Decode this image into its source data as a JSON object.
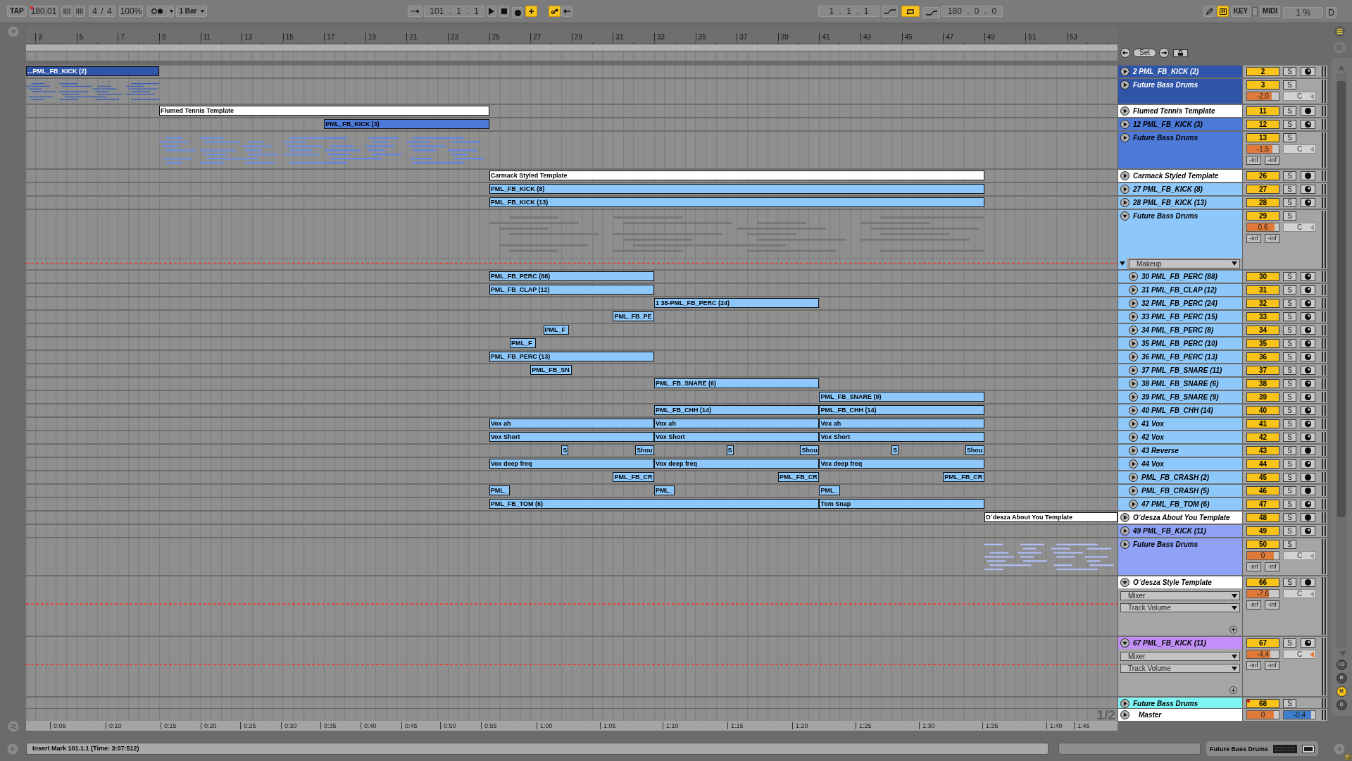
{
  "toolbar": {
    "tap": "TAP",
    "tempo": "180.01",
    "tempo_flag": true,
    "signature": "4 / 4",
    "zoom": "100%",
    "quantization": "1 Bar",
    "position": "101 . 1 . 1",
    "overdub": {
      "label": "+",
      "on": true
    },
    "automation_arm": {
      "on": true
    },
    "loop_start": "1 . 1 . 1",
    "loop": {
      "on": true
    },
    "loop_length": "180 . 0 . 0",
    "keyboard": {
      "on": true
    },
    "key": "KEY",
    "midi": "MIDI",
    "cpu": "1 %",
    "disk": "D"
  },
  "locator": {
    "set": "Set"
  },
  "ruler": [
    "3",
    "5",
    "7",
    "9",
    "11",
    "13",
    "15",
    "17",
    "19",
    "21",
    "23",
    "25",
    "27",
    "29",
    "31",
    "33",
    "35",
    "37",
    "39",
    "41",
    "43",
    "45",
    "47",
    "49",
    "51",
    "53"
  ],
  "tracks": [
    {
      "number": "2",
      "name": "2 PML_FB_KICK (2)",
      "color": "#2e55a8",
      "expanded": false,
      "solo": "S",
      "arm": {
        "kind": "half"
      },
      "clips": [
        {
          "kind": "clip",
          "label": "...PML_FB_KICK (2)"
        }
      ]
    },
    {
      "number": "3",
      "name": "Future Bass Drums",
      "color": "#2e55a8",
      "expanded": false,
      "solo": "S",
      "volume": {
        "text": "-2.0",
        "level": 0.78
      },
      "pan": {
        "text": "C",
        "active": false
      },
      "clips": [
        {
          "kind": "overview",
          "color": "#3b5fb8"
        }
      ]
    },
    {
      "number": "11",
      "name": "Flumed Tennis Template",
      "color": "#ffffff",
      "expanded": false,
      "solo": "S",
      "arm": {
        "kind": "dot"
      },
      "clips": [
        {
          "kind": "clip",
          "label": "Flumed Tennis Template"
        }
      ]
    },
    {
      "number": "12",
      "name": "12 PML_FB_KICK (3)",
      "color": "#4d7ad8",
      "expanded": false,
      "solo": "S",
      "arm": {
        "kind": "half"
      },
      "clips": [
        {
          "kind": "clip",
          "label": "PML_FB_KICK (3)"
        }
      ]
    },
    {
      "number": "13",
      "name": "Future Bass Drums",
      "color": "#4d7ad8",
      "expanded": false,
      "solo": "S",
      "volume": {
        "text": "-1.5",
        "level": 0.81
      },
      "pan": {
        "text": "C",
        "active": false
      },
      "peaks": [
        "-inf",
        "-inf"
      ],
      "clips": [
        {
          "kind": "overview",
          "color": "#6d91e8"
        },
        {
          "kind": "overview",
          "color": "#5f86ea"
        }
      ]
    },
    {
      "number": "26",
      "name": "Carmack Styled Template",
      "color": "#ffffff",
      "expanded": false,
      "solo": "S",
      "arm": {
        "kind": "dot"
      },
      "clips": [
        {
          "kind": "clip",
          "label": "Carmack Styled Template"
        }
      ]
    },
    {
      "number": "27",
      "name": "27 PML_FB_KICK (8)",
      "color": "#8ec8fa",
      "expanded": false,
      "solo": "S",
      "arm": {
        "kind": "half"
      },
      "clips": [
        {
          "kind": "clip",
          "label": "PML_FB_KICK (8)"
        }
      ]
    },
    {
      "number": "28",
      "name": "28 PML_FB_KICK (13)",
      "color": "#8ec8fa",
      "expanded": false,
      "solo": "S",
      "arm": {
        "kind": "half"
      },
      "clips": [
        {
          "kind": "clip",
          "label": "PML_FB_KICK (13)"
        }
      ]
    },
    {
      "number": "29",
      "name": "Future Bass Drums",
      "color": "#8ec8fa",
      "expanded": true,
      "solo": "S",
      "volume": {
        "text": "0.6",
        "level": 0.86
      },
      "pan": {
        "text": "C",
        "active": false
      },
      "peaks": [
        "-inf",
        "-inf"
      ],
      "automation": {
        "kind": "lane",
        "choosers": [
          "Makeup"
        ]
      },
      "clips": [
        {
          "kind": "overview",
          "color": "#767676"
        }
      ],
      "children": [
        {
          "number": "30",
          "name": "30 PML_FB_PERC (88)",
          "color": "#8ec8fa",
          "expanded": false,
          "solo": "S",
          "arm": {
            "kind": "half"
          },
          "clips": [
            {
              "kind": "clip",
              "label": "PML_FB_PERC (88)"
            }
          ]
        },
        {
          "number": "31",
          "name": "31 PML_FB_CLAP (12)",
          "color": "#8ec8fa",
          "expanded": false,
          "solo": "S",
          "arm": {
            "kind": "half"
          },
          "clips": [
            {
              "kind": "clip",
              "label": "PML_FB_CLAP (12)"
            }
          ]
        },
        {
          "number": "32",
          "name": "32 PML_FB_PERC (24)",
          "color": "#8ec8fa",
          "expanded": false,
          "solo": "S",
          "arm": {
            "kind": "half"
          },
          "clips": [
            {
              "kind": "clip",
              "label": "1 38-PML_FB_PERC (24)"
            }
          ]
        },
        {
          "number": "33",
          "name": "33 PML_FB_PERC (15)",
          "color": "#8ec8fa",
          "expanded": false,
          "solo": "S",
          "arm": {
            "kind": "half"
          },
          "clips": [
            {
              "kind": "clip",
              "label": "PML_FB_PE"
            }
          ]
        },
        {
          "number": "34",
          "name": "34 PML_FB_PERC (8)",
          "color": "#8ec8fa",
          "expanded": false,
          "solo": "S",
          "arm": {
            "kind": "half"
          },
          "clips": [
            {
              "kind": "clip",
              "label": "PML_F"
            }
          ]
        },
        {
          "number": "35",
          "name": "35 PML_FB_PERC (10)",
          "color": "#8ec8fa",
          "expanded": false,
          "solo": "S",
          "arm": {
            "kind": "half"
          },
          "clips": [
            {
              "kind": "clip",
              "label": "PML_F"
            }
          ]
        },
        {
          "number": "36",
          "name": "36 PML_FB_PERC (13)",
          "color": "#8ec8fa",
          "expanded": false,
          "solo": "S",
          "arm": {
            "kind": "half"
          },
          "clips": [
            {
              "kind": "clip",
              "label": "PML_FB_PERC (13)"
            }
          ]
        },
        {
          "number": "37",
          "name": "37 PML_FB_SNARE (11)",
          "color": "#8ec8fa",
          "expanded": false,
          "solo": "S",
          "arm": {
            "kind": "half"
          },
          "clips": [
            {
              "kind": "clip",
              "label": "PML_FB_SN"
            }
          ]
        },
        {
          "number": "38",
          "name": "38 PML_FB_SNARE (6)",
          "color": "#8ec8fa",
          "expanded": false,
          "solo": "S",
          "arm": {
            "kind": "half"
          },
          "clips": [
            {
              "kind": "clip",
              "label": "PML_FB_SNARE (6)"
            }
          ]
        },
        {
          "number": "39",
          "name": "39 PML_FB_SNARE (9)",
          "color": "#8ec8fa",
          "expanded": false,
          "solo": "S",
          "arm": {
            "kind": "half"
          },
          "clips": [
            {
              "kind": "clip",
              "label": "PML_FB_SNARE (9)"
            }
          ]
        },
        {
          "number": "40",
          "name": "40 PML_FB_CHH (14)",
          "color": "#8ec8fa",
          "expanded": false,
          "solo": "S",
          "arm": {
            "kind": "half"
          },
          "clips": [
            {
              "kind": "clip",
              "label": "PML_FB_CHH (14)"
            },
            {
              "kind": "clip",
              "label": "PML_FB_CHH (14)"
            }
          ]
        },
        {
          "number": "41",
          "name": "41 Vox",
          "color": "#8ec8fa",
          "expanded": false,
          "solo": "S",
          "arm": {
            "kind": "half"
          },
          "clips": [
            {
              "kind": "clip",
              "label": "Vox ah"
            },
            {
              "kind": "clip",
              "label": "Vox ah"
            },
            {
              "kind": "clip",
              "label": "Vox ah"
            }
          ]
        },
        {
          "number": "42",
          "name": "42 Vox",
          "color": "#8ec8fa",
          "expanded": false,
          "solo": "S",
          "arm": {
            "kind": "half"
          },
          "clips": [
            {
              "kind": "clip",
              "label": "Vox Short"
            },
            {
              "kind": "clip",
              "label": "Vox Short"
            },
            {
              "kind": "clip",
              "label": "Vox Short"
            }
          ]
        },
        {
          "number": "43",
          "name": "43 Reverse",
          "color": "#8ec8fa",
          "expanded": false,
          "solo": "S",
          "arm": {
            "kind": "dot"
          },
          "clips": [
            {
              "kind": "clip",
              "label": "S"
            },
            {
              "kind": "clip",
              "label": "Shou"
            },
            {
              "kind": "clip",
              "label": "S"
            },
            {
              "kind": "clip",
              "label": "Shou"
            },
            {
              "kind": "clip",
              "label": "S"
            },
            {
              "kind": "clip",
              "label": "Shou"
            }
          ]
        },
        {
          "number": "44",
          "name": "44 Vox",
          "color": "#8ec8fa",
          "expanded": false,
          "solo": "S",
          "arm": {
            "kind": "half"
          },
          "clips": [
            {
              "kind": "clip",
              "label": "Vox deep freq"
            },
            {
              "kind": "clip",
              "label": "Vox deep freq"
            },
            {
              "kind": "clip",
              "label": "Vox deep freq"
            }
          ]
        },
        {
          "number": "45",
          "name": "PML_FB_CRASH (2)",
          "color": "#8ec8fa",
          "expanded": false,
          "solo": "S",
          "arm": {
            "kind": "dot"
          },
          "clips": [
            {
              "kind": "clip",
              "label": "PML_FB_CR"
            },
            {
              "kind": "clip",
              "label": "PML_FB_CR"
            },
            {
              "kind": "clip",
              "label": "PML_FB_CR"
            }
          ]
        },
        {
          "number": "46",
          "name": "PML_FB_CRASH (5)",
          "color": "#8ec8fa",
          "expanded": false,
          "solo": "S",
          "arm": {
            "kind": "dot"
          },
          "clips": [
            {
              "kind": "clip",
              "label": "PML_"
            },
            {
              "kind": "clip",
              "label": "PML_"
            },
            {
              "kind": "clip",
              "label": "PML_"
            }
          ]
        },
        {
          "number": "47",
          "name": "47 PML_FB_TOM (6)",
          "color": "#8ec8fa",
          "expanded": false,
          "solo": "S",
          "arm": {
            "kind": "half"
          },
          "clips": [
            {
              "kind": "clip",
              "label": "PML_FB_TOM (6)"
            },
            {
              "kind": "clip",
              "label": "Tom Snap"
            }
          ]
        }
      ]
    },
    {
      "number": "48",
      "name": "O´desza About You Template",
      "color": "#ffffff",
      "expanded": false,
      "solo": "S",
      "arm": {
        "kind": "dot"
      },
      "clips": [
        {
          "kind": "clip",
          "label": "O´desza About You Template"
        }
      ]
    },
    {
      "number": "49",
      "name": "49 PML_FB_KICK (11)",
      "color": "#8fa2f5",
      "expanded": false,
      "solo": "S",
      "arm": {
        "kind": "half"
      }
    },
    {
      "number": "50",
      "name": "Future Bass Drums",
      "color": "#8fa2f5",
      "expanded": false,
      "solo": "S",
      "volume": {
        "text": "0",
        "level": 0.84
      },
      "pan": {
        "text": "C",
        "active": false
      },
      "peaks": [
        "-inf",
        "-inf"
      ],
      "clips": [
        {
          "kind": "overview",
          "color": "#b0befa"
        }
      ]
    },
    {
      "number": "66",
      "name": "O´desza Style Template",
      "color": "#ffffff",
      "expanded": true,
      "solo": "S",
      "arm": {
        "kind": "dot"
      },
      "volume": {
        "text": "-7.6",
        "level": 0.68
      },
      "pan": {
        "text": "C",
        "active": false
      },
      "peaks": [
        "-inf",
        "-inf"
      ],
      "automation": {
        "kind": "inline",
        "choosers": [
          "Mixer",
          "Track Volume"
        ],
        "add_lane": true
      }
    },
    {
      "number": "67",
      "name": "67 PML_FB_KICK (11)",
      "color": "#c18ff7",
      "expanded": true,
      "solo": "S",
      "arm": {
        "kind": "half"
      },
      "volume": {
        "text": "-4.4",
        "level": 0.74
      },
      "pan": {
        "text": "C",
        "active": true
      },
      "peaks": [
        "-inf",
        "-inf"
      ],
      "automation": {
        "kind": "inline",
        "choosers": [
          "Mixer",
          "Track Volume"
        ],
        "add_lane": true
      }
    },
    {
      "number": "68",
      "name": "Future Bass Drums",
      "color": "#80f5f5",
      "expanded": false,
      "solo": "S",
      "flag": true
    }
  ],
  "master": {
    "name": "Master",
    "expanded": false,
    "volume": {
      "text": "0",
      "level": 0.84
    },
    "cue": {
      "text": "-0.4",
      "level": 0.86
    }
  },
  "grid": "1/2",
  "time_ruler": [
    "0:05",
    "0:10",
    "0:15",
    "0:20",
    "0:25",
    "0:30",
    "0:35",
    "0:40",
    "0:45",
    "0:50",
    "0:55",
    "1:00",
    "1:05",
    "1:10",
    "1:15",
    "1:20",
    "1:25",
    "1:30",
    "1:35",
    "1:40",
    "1:45"
  ],
  "side_buttons": [
    {
      "label": "I·O",
      "on": false
    },
    {
      "label": "R",
      "on": false
    },
    {
      "label": "M",
      "on": true
    },
    {
      "label": "D",
      "on": false
    }
  ],
  "status_bar": {
    "message": "Insert Mark 101.1.1 (Time: 3:07:512)",
    "track": "Future Bass Drums"
  }
}
